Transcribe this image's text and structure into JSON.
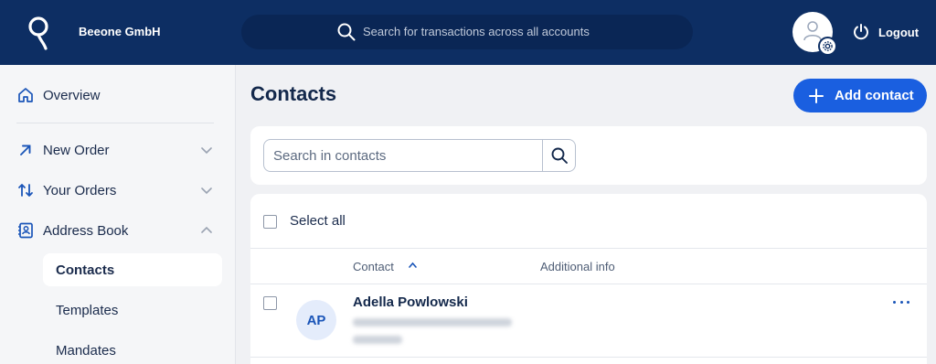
{
  "header": {
    "org_name": "Beeone GmbH",
    "search_placeholder": "Search for transactions across all accounts",
    "logout_label": "Logout"
  },
  "sidebar": {
    "items": [
      {
        "label": "Overview",
        "icon": "home-icon"
      },
      {
        "label": "New Order",
        "icon": "arrow-up-right-icon",
        "expanded": false
      },
      {
        "label": "Your Orders",
        "icon": "swap-vertical-icon",
        "expanded": false
      },
      {
        "label": "Address Book",
        "icon": "address-book-icon",
        "expanded": true
      }
    ],
    "sub_items": [
      {
        "label": "Contacts",
        "active": true
      },
      {
        "label": "Templates",
        "active": false
      },
      {
        "label": "Mandates",
        "active": false
      }
    ]
  },
  "main": {
    "title": "Contacts",
    "add_button_label": "Add contact",
    "search_placeholder": "Search in contacts",
    "select_all_label": "Select all",
    "columns": [
      "Contact",
      "Additional info"
    ],
    "rows": [
      {
        "initials": "AP",
        "name": "Adella Powlowski"
      }
    ]
  },
  "colors": {
    "header_bg": "#0d2e63",
    "accent": "#1a5fe0",
    "sidebar_bg": "#f5f6f8",
    "page_bg": "#f0f1f4"
  }
}
